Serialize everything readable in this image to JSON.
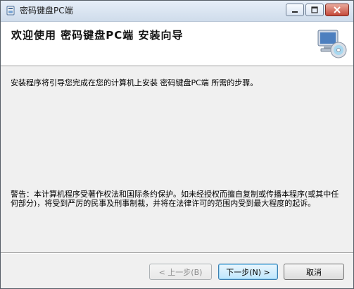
{
  "window": {
    "title": "密码键盘PC端",
    "controls": {
      "minimize_icon": "minimize-icon",
      "maximize_icon": "maximize-icon",
      "close_icon": "close-icon"
    }
  },
  "header": {
    "title": "欢迎使用 密码键盘PC端 安装向导",
    "art_icon": "computer-cd-icon"
  },
  "body": {
    "intro": "安装程序将引导您完成在您的计算机上安装 密码键盘PC端 所需的步骤。",
    "warning": "警告：本计算机程序受著作权法和国际条约保护。如未经授权而擅自复制或传播本程序(或其中任何部分)，将受到严厉的民事及刑事制裁，并将在法律许可的范围内受到最大程度的起诉。"
  },
  "buttons": {
    "back": "< 上一步(B)",
    "next": "下一步(N) >",
    "cancel": "取消"
  },
  "colors": {
    "window_bg": "#f0f0f0",
    "header_bg": "#ffffff",
    "close_red": "#c5493a"
  }
}
